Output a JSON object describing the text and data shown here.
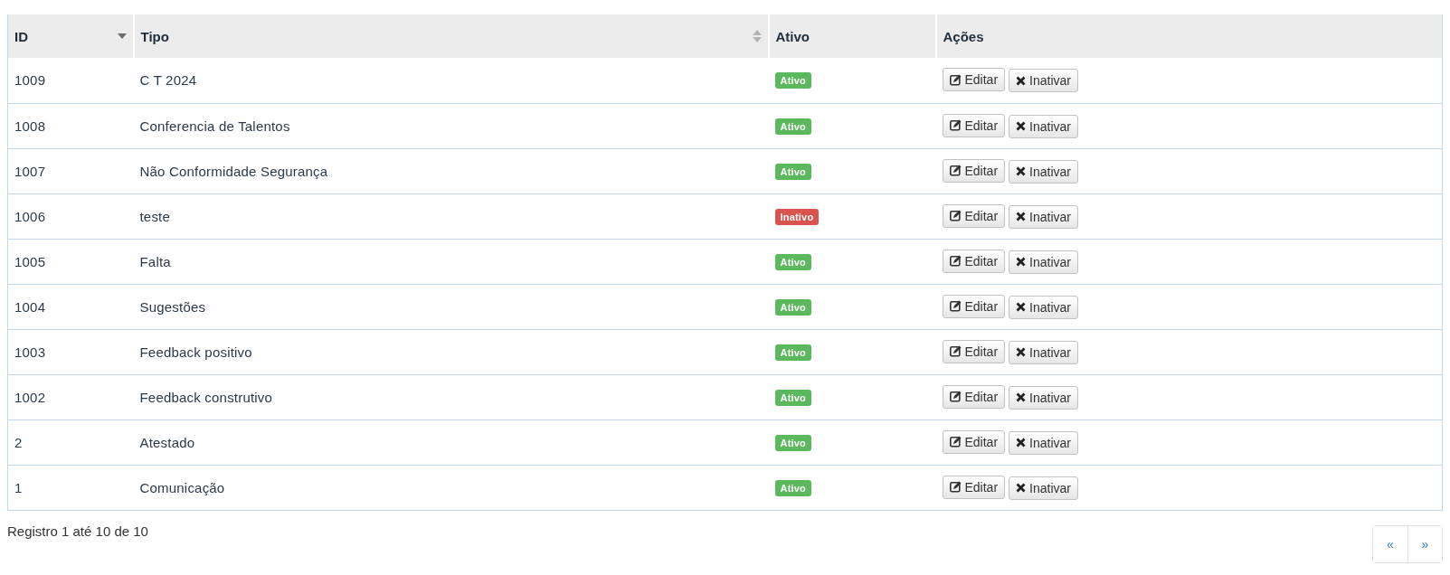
{
  "table": {
    "columns": [
      {
        "label": "ID",
        "sortable": true,
        "sorted_descending": true
      },
      {
        "label": "Tipo",
        "sortable": true,
        "sorted_descending": false
      },
      {
        "label": "Ativo",
        "sortable": false
      },
      {
        "label": "Ações",
        "sortable": false
      }
    ],
    "rows": [
      {
        "id": "1009",
        "tipo": "C T 2024",
        "status": {
          "label": "Ativo",
          "active": true
        },
        "actions": [
          "Editar",
          "Inativar"
        ]
      },
      {
        "id": "1008",
        "tipo": "Conferencia de Talentos",
        "status": {
          "label": "Ativo",
          "active": true
        },
        "actions": [
          "Editar",
          "Inativar"
        ]
      },
      {
        "id": "1007",
        "tipo": "Não Conformidade Segurança",
        "status": {
          "label": "Ativo",
          "active": true
        },
        "actions": [
          "Editar",
          "Inativar"
        ]
      },
      {
        "id": "1006",
        "tipo": "teste",
        "status": {
          "label": "Inativo",
          "active": false
        },
        "actions": [
          "Editar",
          "Inativar"
        ]
      },
      {
        "id": "1005",
        "tipo": "Falta",
        "status": {
          "label": "Ativo",
          "active": true
        },
        "actions": [
          "Editar",
          "Inativar"
        ]
      },
      {
        "id": "1004",
        "tipo": "Sugestões",
        "status": {
          "label": "Ativo",
          "active": true
        },
        "actions": [
          "Editar",
          "Inativar"
        ]
      },
      {
        "id": "1003",
        "tipo": "Feedback positivo",
        "status": {
          "label": "Ativo",
          "active": true
        },
        "actions": [
          "Editar",
          "Inativar"
        ]
      },
      {
        "id": "1002",
        "tipo": "Feedback construtivo",
        "status": {
          "label": "Ativo",
          "active": true
        },
        "actions": [
          "Editar",
          "Inativar"
        ]
      },
      {
        "id": "2",
        "tipo": "Atestado",
        "status": {
          "label": "Ativo",
          "active": true
        },
        "actions": [
          "Editar",
          "Inativar"
        ]
      },
      {
        "id": "1",
        "tipo": "Comunicação",
        "status": {
          "label": "Ativo",
          "active": true
        },
        "actions": [
          "Editar",
          "Inativar"
        ]
      }
    ]
  },
  "footer": {
    "info": "Registro 1 até 10 de 10",
    "pagination": [
      {
        "label": "«"
      },
      {
        "label": "»"
      }
    ]
  }
}
